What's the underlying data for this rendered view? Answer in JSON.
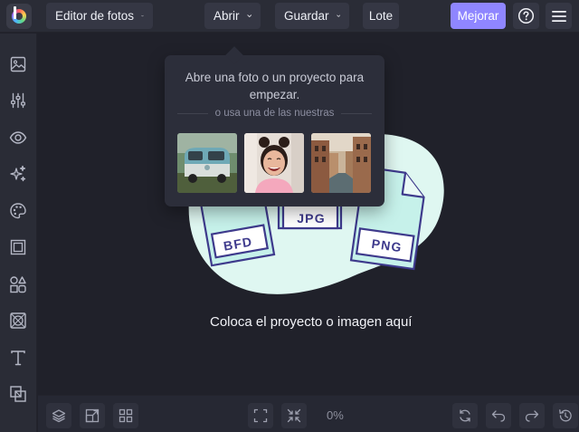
{
  "toolbar": {
    "logo_icon": "befunky-logo-icon",
    "editor_label": "Editor de fotos",
    "open_label": "Abrir",
    "save_label": "Guardar",
    "batch_label": "Lote",
    "enhance_label": "Mejorar",
    "help_icon": "question-circle-icon",
    "menu_icon": "hamburger-menu-icon",
    "accent_color": "#8f86ff"
  },
  "sidebar": {
    "items": [
      {
        "icon": "image-icon"
      },
      {
        "icon": "sliders-icon"
      },
      {
        "icon": "eye-icon"
      },
      {
        "icon": "sparkles-icon"
      },
      {
        "icon": "palette-icon"
      },
      {
        "icon": "frame-icon"
      },
      {
        "icon": "shapes-icon"
      },
      {
        "icon": "texture-icon"
      },
      {
        "icon": "text-icon"
      },
      {
        "icon": "layers-square-icon"
      }
    ]
  },
  "open_popover": {
    "title": "Abre una foto o un proyecto para empezar.",
    "subtitle": "o usa una de las nuestras",
    "samples": [
      {
        "name": "sample-van"
      },
      {
        "name": "sample-woman-laughing"
      },
      {
        "name": "sample-canal-city"
      }
    ]
  },
  "drop_area": {
    "formats": [
      "BFD",
      "JPG",
      "PNG"
    ],
    "hint": "Coloca el proyecto o imagen aquí",
    "blob_color": "#dff7f1",
    "file_stroke_color": "#3e3a8c"
  },
  "bottom_bar": {
    "zoom": "0%",
    "left_icons": [
      "layers-icon",
      "resize-icon",
      "grid-icon"
    ],
    "center_icons": [
      "fit-screen-icon",
      "actual-size-icon"
    ],
    "right_icons": [
      "compare-icon",
      "undo-icon",
      "redo-icon",
      "history-icon"
    ]
  }
}
